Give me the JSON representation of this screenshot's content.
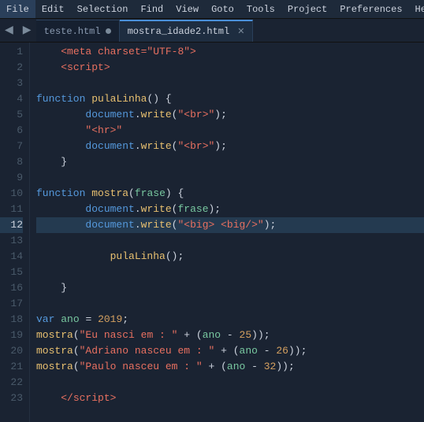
{
  "menubar": {
    "items": [
      "File",
      "Edit",
      "Selection",
      "Find",
      "View",
      "Goto",
      "Tools",
      "Project",
      "Preferences",
      "Help"
    ]
  },
  "tabbar": {
    "nav_left": "◀",
    "nav_right": "▶",
    "tabs": [
      {
        "label": "teste.html",
        "active": false,
        "has_dot": true,
        "closable": false
      },
      {
        "label": "mostra_idade2.html",
        "active": true,
        "has_dot": false,
        "closable": true
      }
    ]
  },
  "lines": [
    1,
    2,
    3,
    4,
    5,
    6,
    7,
    8,
    9,
    10,
    11,
    12,
    13,
    14,
    15,
    16,
    17,
    18,
    19,
    20,
    21,
    22,
    23
  ],
  "highlighted_line": 12
}
